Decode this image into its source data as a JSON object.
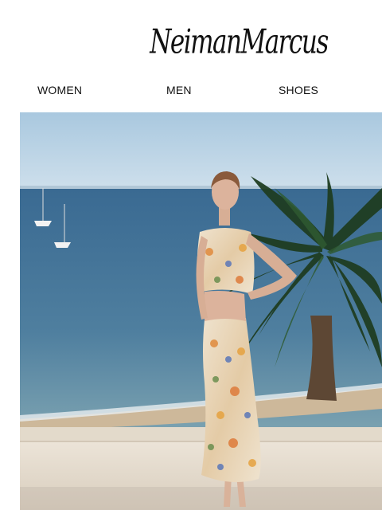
{
  "brand": {
    "logo_text": "NeimanMarcus"
  },
  "nav": {
    "items": [
      {
        "label": "WOMEN"
      },
      {
        "label": "MEN"
      },
      {
        "label": "SHOES"
      }
    ]
  },
  "hero": {
    "subject": "model-floral-crop-top-and-skirt-seaside",
    "colors": {
      "sky": "#b9d3e6",
      "sea": "#3e6f96",
      "wall": "#e6ddd0"
    }
  }
}
